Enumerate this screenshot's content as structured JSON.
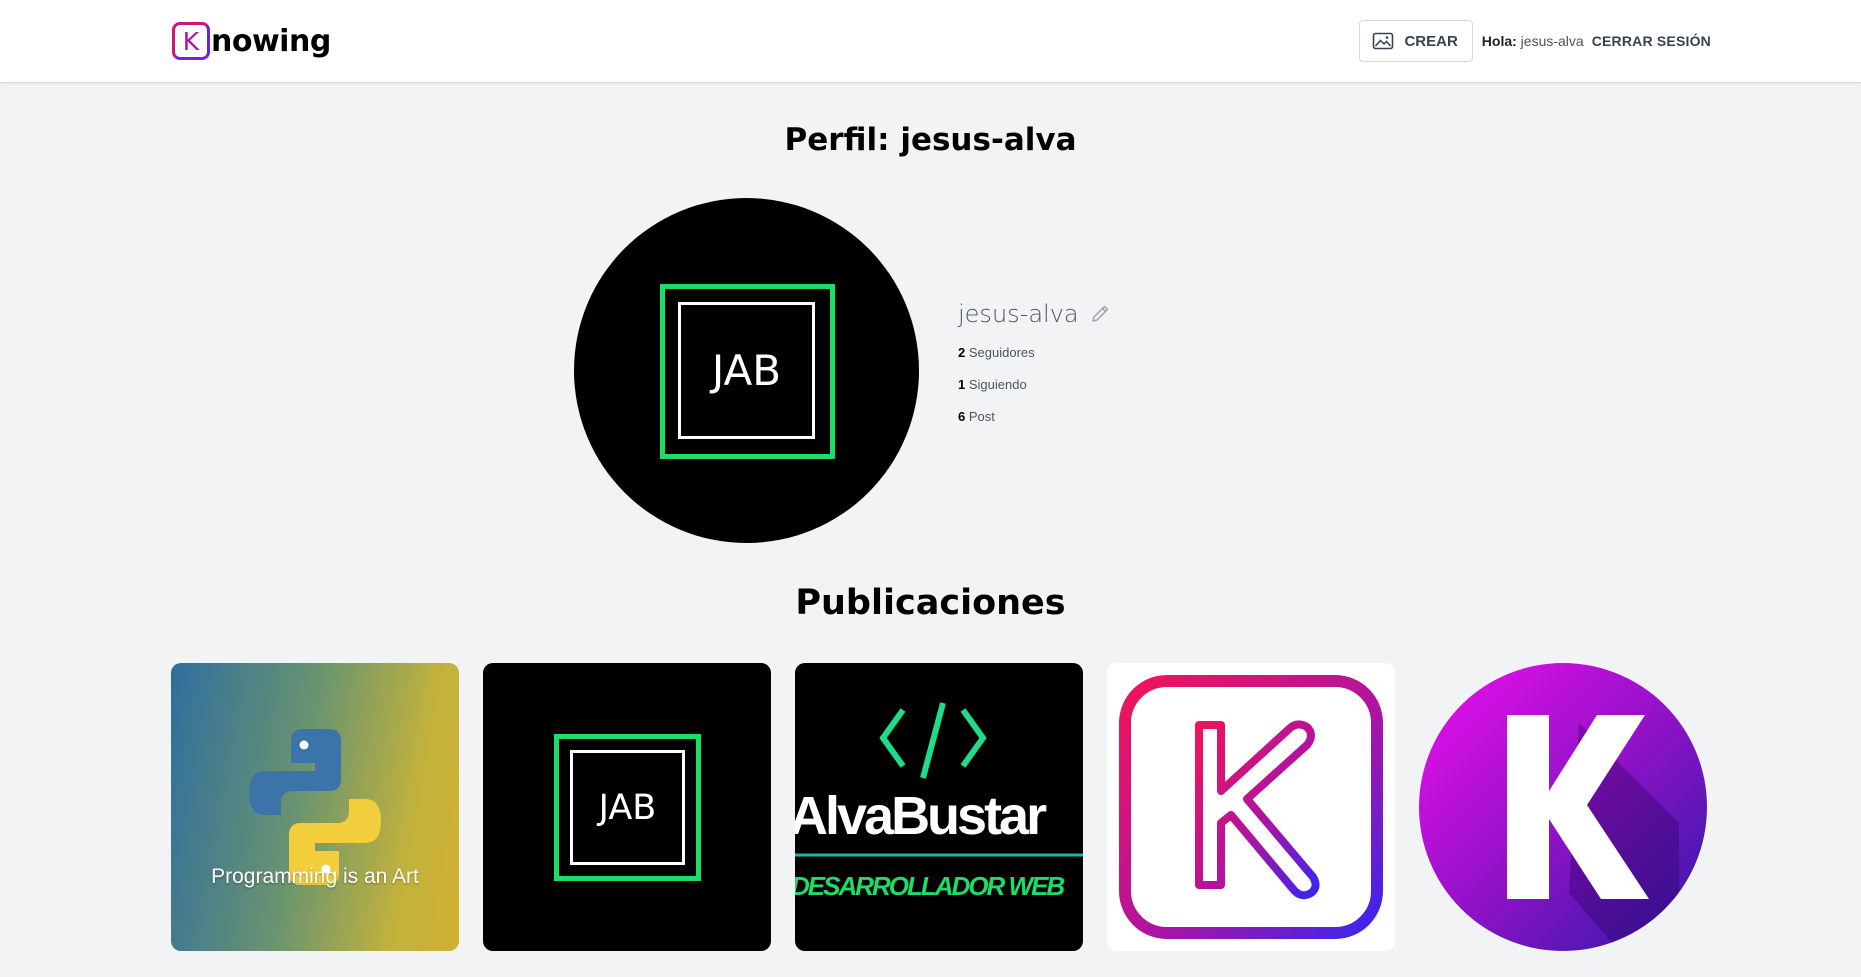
{
  "header": {
    "logo_letter": "K",
    "logo_text": "nowing",
    "create_label": "CREAR",
    "greeting_label": "Hola:",
    "greeting_user": "jesus-alva",
    "logout_label": "CERRAR SESIÓN"
  },
  "profile": {
    "title": "Perfil: jesus-alva",
    "avatar_text": "JAB",
    "username": "jesus-alva",
    "stats": [
      {
        "value": "2",
        "label": "Seguidores"
      },
      {
        "value": "1",
        "label": "Siguiendo"
      },
      {
        "value": "6",
        "label": "Post"
      }
    ]
  },
  "posts": {
    "title": "Publicaciones",
    "items": [
      {
        "image_text": "Programming is an Art"
      },
      {
        "image_text": "JAB"
      },
      {
        "image_text_line1": "AlvaBustar",
        "image_text_line2": "DESARROLLADOR WEB"
      },
      {
        "image_text": "K"
      },
      {
        "image_text": "K"
      }
    ]
  },
  "colors": {
    "accent_green": "#1fdc69",
    "brand_pink": "#d0157a",
    "brand_purple": "#6a22e0"
  }
}
